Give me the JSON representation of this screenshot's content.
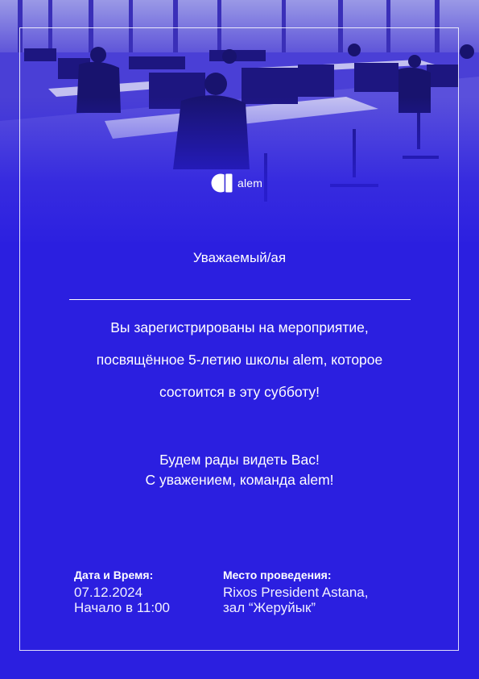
{
  "logo": {
    "icon": "alem-logo-icon",
    "text": "alem"
  },
  "greeting": "Уважаемый/ая",
  "message": {
    "line1": "Вы зарегистрированы на мероприятие,",
    "line2": "посвящённое 5-летию школы alem, которое",
    "line3": "состоится в эту субботу!"
  },
  "closing": {
    "line1": "Будем рады видеть Вас!",
    "line2": "С уважением, команда alem!"
  },
  "datetime": {
    "label": "Дата и Время:",
    "date": "07.12.2024",
    "time": "Начало в 11:00"
  },
  "venue": {
    "label": "Место проведения:",
    "line1": "Rixos President Astana,",
    "line2": "зал “Жеруйык”"
  },
  "colors": {
    "background": "#2b1fe0",
    "text": "#ffffff"
  }
}
